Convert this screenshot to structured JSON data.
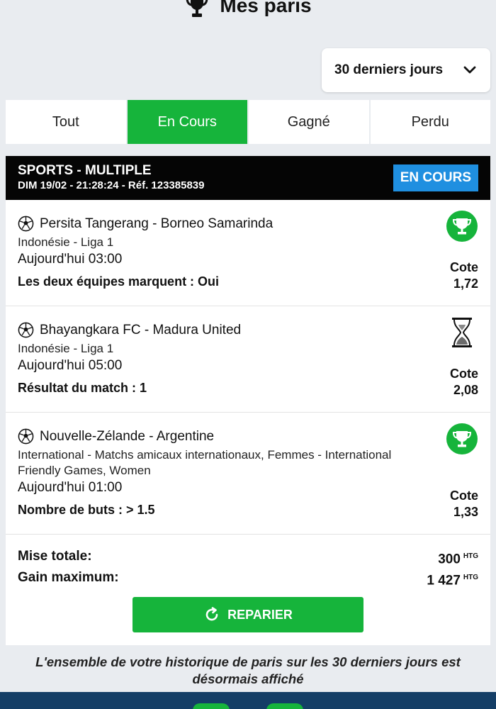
{
  "header": {
    "title": "Mes paris",
    "icon": "trophy-icon"
  },
  "period_select": {
    "value": "30 derniers jours",
    "icon": "chevron-down-icon"
  },
  "tabs": [
    {
      "label": "Tout",
      "active": false
    },
    {
      "label": "En Cours",
      "active": true
    },
    {
      "label": "Gagné",
      "active": false
    },
    {
      "label": "Perdu",
      "active": false
    }
  ],
  "ticket": {
    "type": "SPORTS - MULTIPLE",
    "meta": "DIM 19/02 - 21:28:24 - Réf. 123385839",
    "status": "EN COURS",
    "colors": {
      "accent": "#16b43b",
      "badge": "#1f8fe0",
      "header": "#050505"
    },
    "bets": [
      {
        "match": "Persita Tangerang - Borneo Samarinda",
        "competition": "Indonésie  -  Liga 1",
        "time": "Aujourd'hui 03:00",
        "selection": "Les deux équipes marquent : Oui",
        "cote_label": "Cote",
        "cote": "1,72",
        "status_icon": "trophy-won-icon"
      },
      {
        "match": "Bhayangkara FC - Madura United",
        "competition": "Indonésie  -  Liga 1",
        "time": "Aujourd'hui 05:00",
        "selection": "Résultat du match : 1",
        "cote_label": "Cote",
        "cote": "2,08",
        "status_icon": "hourglass-icon"
      },
      {
        "match": "Nouvelle-Zélande - Argentine",
        "competition": "International  -  Matchs amicaux internationaux, Femmes  -  International Friendly Games, Women",
        "time": "Aujourd'hui 01:00",
        "selection": "Nombre de buts : > 1.5",
        "cote_label": "Cote",
        "cote": "1,33",
        "status_icon": "trophy-won-icon"
      }
    ],
    "totals": {
      "stake_label": "Mise totale:",
      "stake_value": "300",
      "gain_label": "Gain maximum:",
      "gain_value": "1 427",
      "currency": "HTG"
    },
    "repair_button": "REPARIER"
  },
  "footer_text": "L'ensemble de votre historique de paris sur les 30 derniers jours est désormais affiché"
}
